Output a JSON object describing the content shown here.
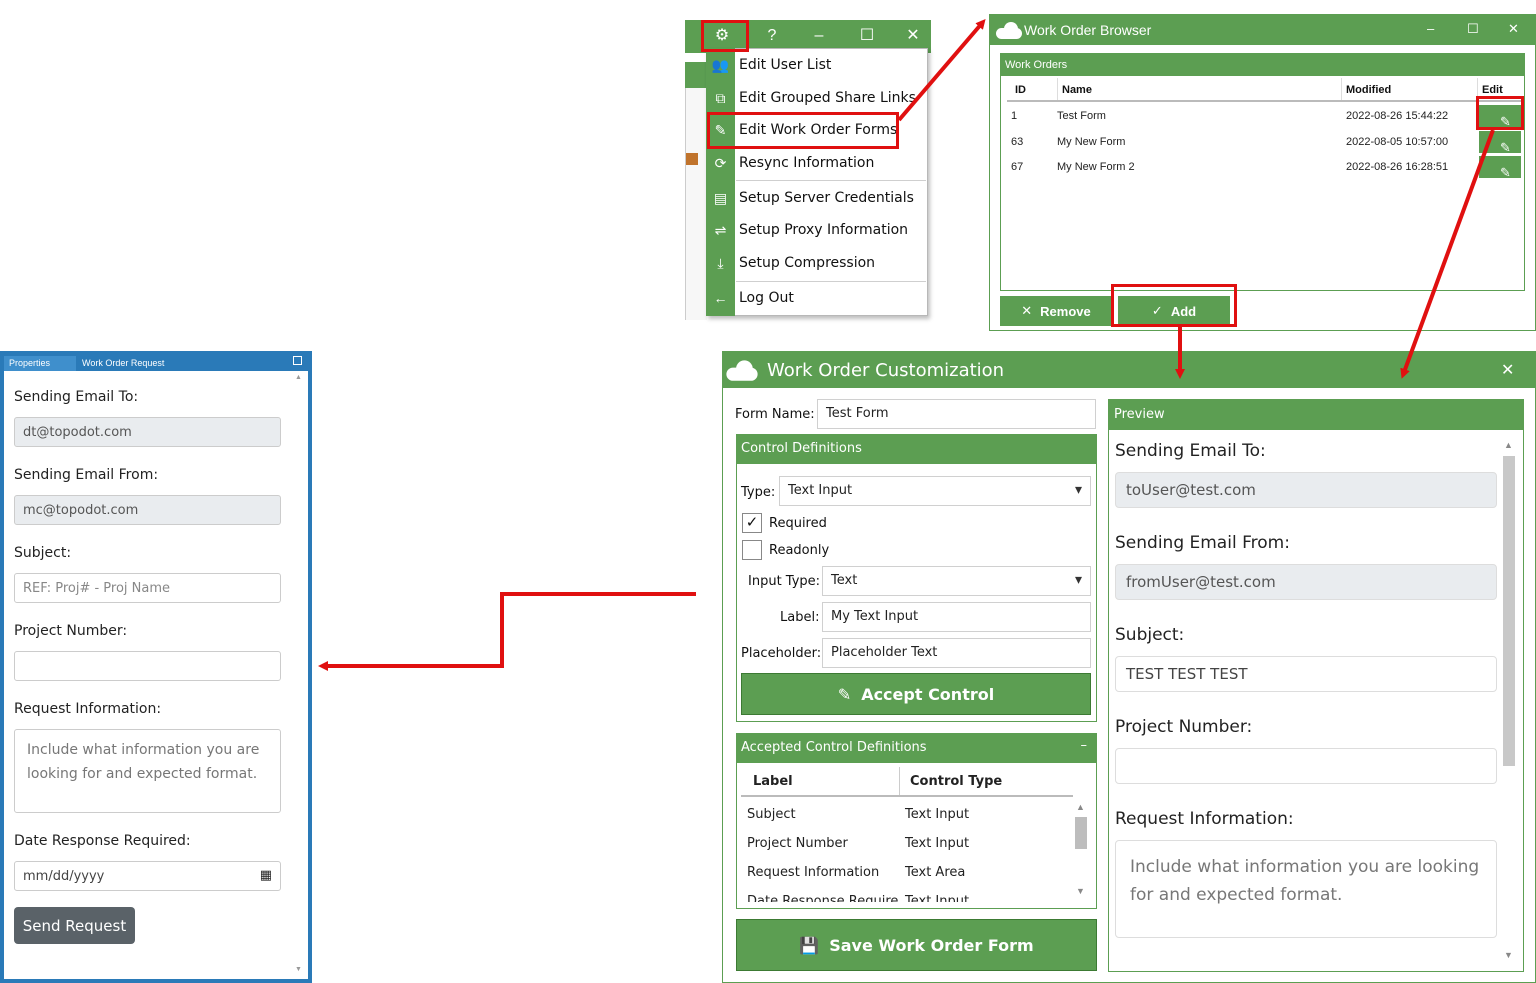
{
  "settings_menu": {
    "items": [
      {
        "label": "Edit User List",
        "icon": "users-icon"
      },
      {
        "label": "Edit Grouped Share Links",
        "icon": "share-link-icon"
      },
      {
        "label": "Edit Work Order Forms",
        "icon": "form-icon"
      },
      {
        "label": "Resync Information",
        "icon": "resync-icon"
      },
      {
        "label": "Setup Server Credentials",
        "icon": "server-icon"
      },
      {
        "label": "Setup Proxy Information",
        "icon": "proxy-icon"
      },
      {
        "label": "Setup Compression",
        "icon": "compression-icon"
      },
      {
        "label": "Log Out",
        "icon": "arrow-left-icon"
      }
    ]
  },
  "browser": {
    "title": "Work Order Browser",
    "group_title": "Work Orders",
    "columns": [
      "ID",
      "Name",
      "Modified",
      "Edit"
    ],
    "rows": [
      {
        "id": "1",
        "name": "Test Form",
        "modified": "2022-08-26 15:44:22"
      },
      {
        "id": "63",
        "name": "My New Form",
        "modified": "2022-08-05 10:57:00"
      },
      {
        "id": "67",
        "name": "My New Form 2",
        "modified": "2022-08-26 16:28:51"
      }
    ],
    "remove_label": "Remove",
    "add_label": "Add"
  },
  "customization": {
    "title": "Work Order Customization",
    "form_name_label": "Form Name:",
    "form_name_value": "Test Form",
    "control_defs_title": "Control Definitions",
    "type_label": "Type:",
    "type_value": "Text Input",
    "required_label": "Required",
    "required_checked": true,
    "readonly_label": "Readonly",
    "readonly_checked": false,
    "input_type_label": "Input Type:",
    "input_type_value": "Text",
    "label_label": "Label:",
    "label_value": "My Text Input",
    "placeholder_label": "Placeholder:",
    "placeholder_value": "Placeholder Text",
    "accept_label": "Accept Control",
    "accepted_title": "Accepted Control Definitions",
    "accepted_collapse": "–",
    "accepted_columns": [
      "Label",
      "Control Type"
    ],
    "accepted_rows": [
      {
        "label": "Subject",
        "type": "Text Input"
      },
      {
        "label": "Project Number",
        "type": "Text Input"
      },
      {
        "label": "Request Information",
        "type": "Text Area"
      },
      {
        "label": "Date Response Requirec",
        "type": "Text Input"
      }
    ],
    "save_label": "Save Work Order Form"
  },
  "preview": {
    "title": "Preview",
    "sending_to_label": "Sending Email To:",
    "sending_to_value": "toUser@test.com",
    "sending_from_label": "Sending Email From:",
    "sending_from_value": "fromUser@test.com",
    "subject_label": "Subject:",
    "subject_value": "TEST TEST TEST",
    "project_label": "Project Number:",
    "request_label": "Request Information:",
    "request_placeholder": "Include what information you are looking for and expected format."
  },
  "web_form": {
    "tabs": [
      "Properties",
      "Work Order Request"
    ],
    "sending_to_label": "Sending Email To:",
    "sending_to_value": "dt@topodot.com",
    "sending_from_label": "Sending Email From:",
    "sending_from_value": "mc@topodot.com",
    "subject_label": "Subject:",
    "subject_placeholder": "REF: Proj# - Proj Name",
    "project_label": "Project Number:",
    "request_label": "Request Information:",
    "request_placeholder": "Include what information you are looking for and expected format.",
    "date_label": "Date Response Required:",
    "date_placeholder": "mm/dd/yyyy",
    "send_label": "Send Request"
  },
  "colors": {
    "accent_green": "#5c9e52",
    "annotation_red": "#e01010",
    "web_form_blue": "#2a7ab8"
  }
}
